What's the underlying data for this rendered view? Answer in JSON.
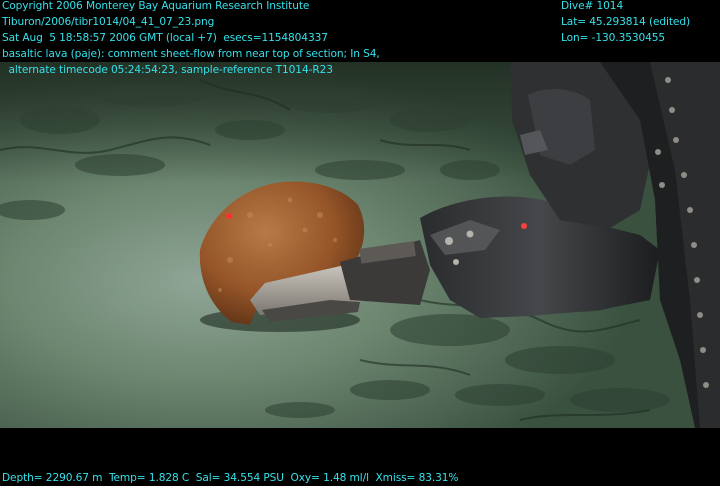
{
  "overlay": {
    "copyright": "Copyright 2006 Monterey Bay Aquarium Research Institute",
    "file_path": "Tiburon/2006/tibr1014/04_41_07_23.png",
    "timestamp": "Sat Aug  5 18:58:57 2006 GMT (local +7)  esecs=1154804337",
    "comment_line1": "basaltic lava (paje): comment sheet-flow from near top of section; In S4,",
    "comment_line2": "  alternate timecode 05:24:54:23, sample-reference T1014-R23",
    "dive": "Dive# 1014",
    "lat": "Lat= 45.293814 (edited)",
    "lon": "Lon= -130.3530455",
    "telemetry": "Depth= 2290.67 m  Temp= 1.828 C  Sal= 34.554 PSU  Oxy= 1.48 ml/l  Xmiss= 83.31%"
  },
  "colors": {
    "overlay_text": "#35e1ea",
    "seafloor": "#3f5a41",
    "sediment_glow": "#93a89a",
    "rock_sample": "#9a5a2f",
    "manipulator_arm": "#2f3032"
  }
}
